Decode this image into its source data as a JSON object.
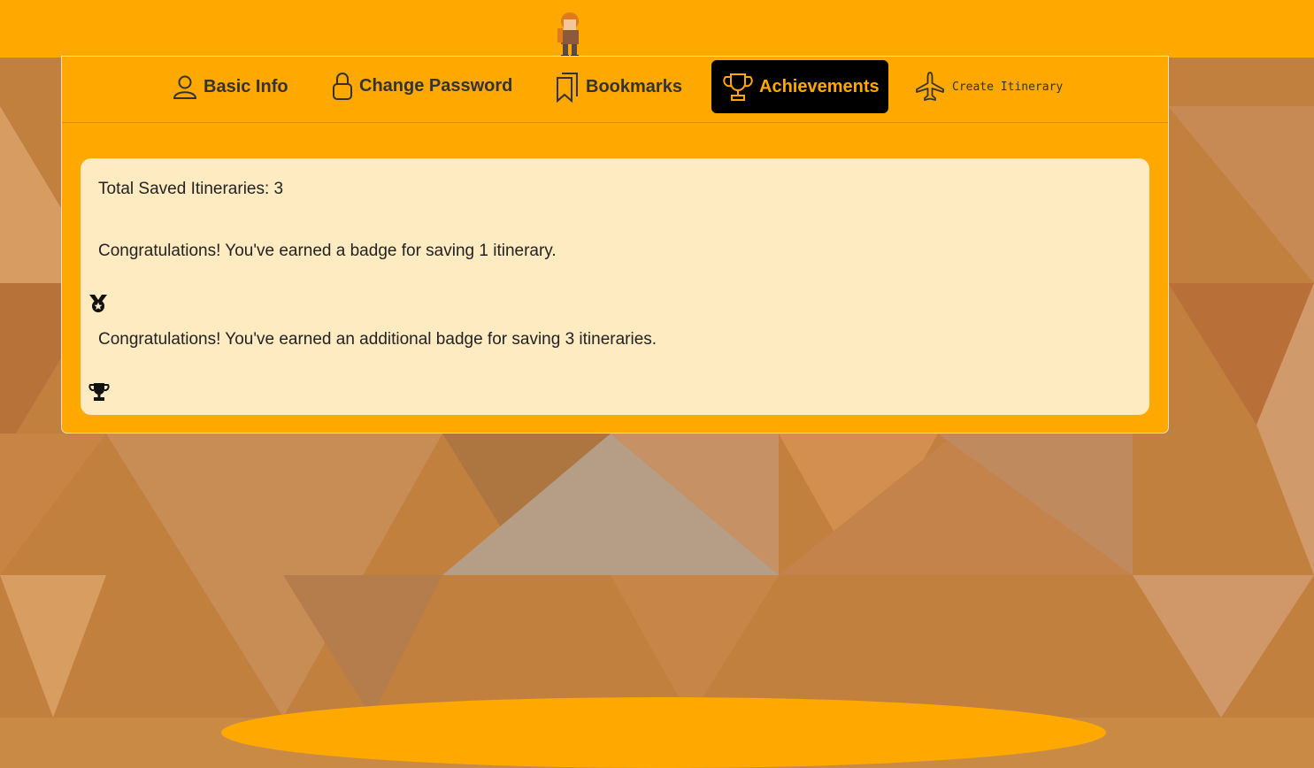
{
  "tabs": [
    {
      "label": "Basic Info",
      "icon": "user-icon",
      "active": false
    },
    {
      "label": "Change Password",
      "icon": "lock-icon",
      "active": false
    },
    {
      "label": "Bookmarks",
      "icon": "bookmarks-icon",
      "active": false
    },
    {
      "label": "Achievements",
      "icon": "trophy-icon",
      "active": true
    },
    {
      "label": "Create Itinerary",
      "icon": "airplane-icon",
      "active": false
    }
  ],
  "achievements": {
    "total_text": "Total Saved Itineraries: 3",
    "badge1_text": "Congratulations! You've earned a badge for saving 1 itinerary.",
    "badge1_icon": "medal-icon",
    "badge2_text": "Congratulations! You've earned an additional badge for saving 3 itineraries.",
    "badge2_icon": "trophy-icon"
  },
  "colors": {
    "accent": "#ffa800",
    "active_tab_bg": "#000000",
    "panel_bg": "#ffebc2",
    "text": "#222222"
  }
}
